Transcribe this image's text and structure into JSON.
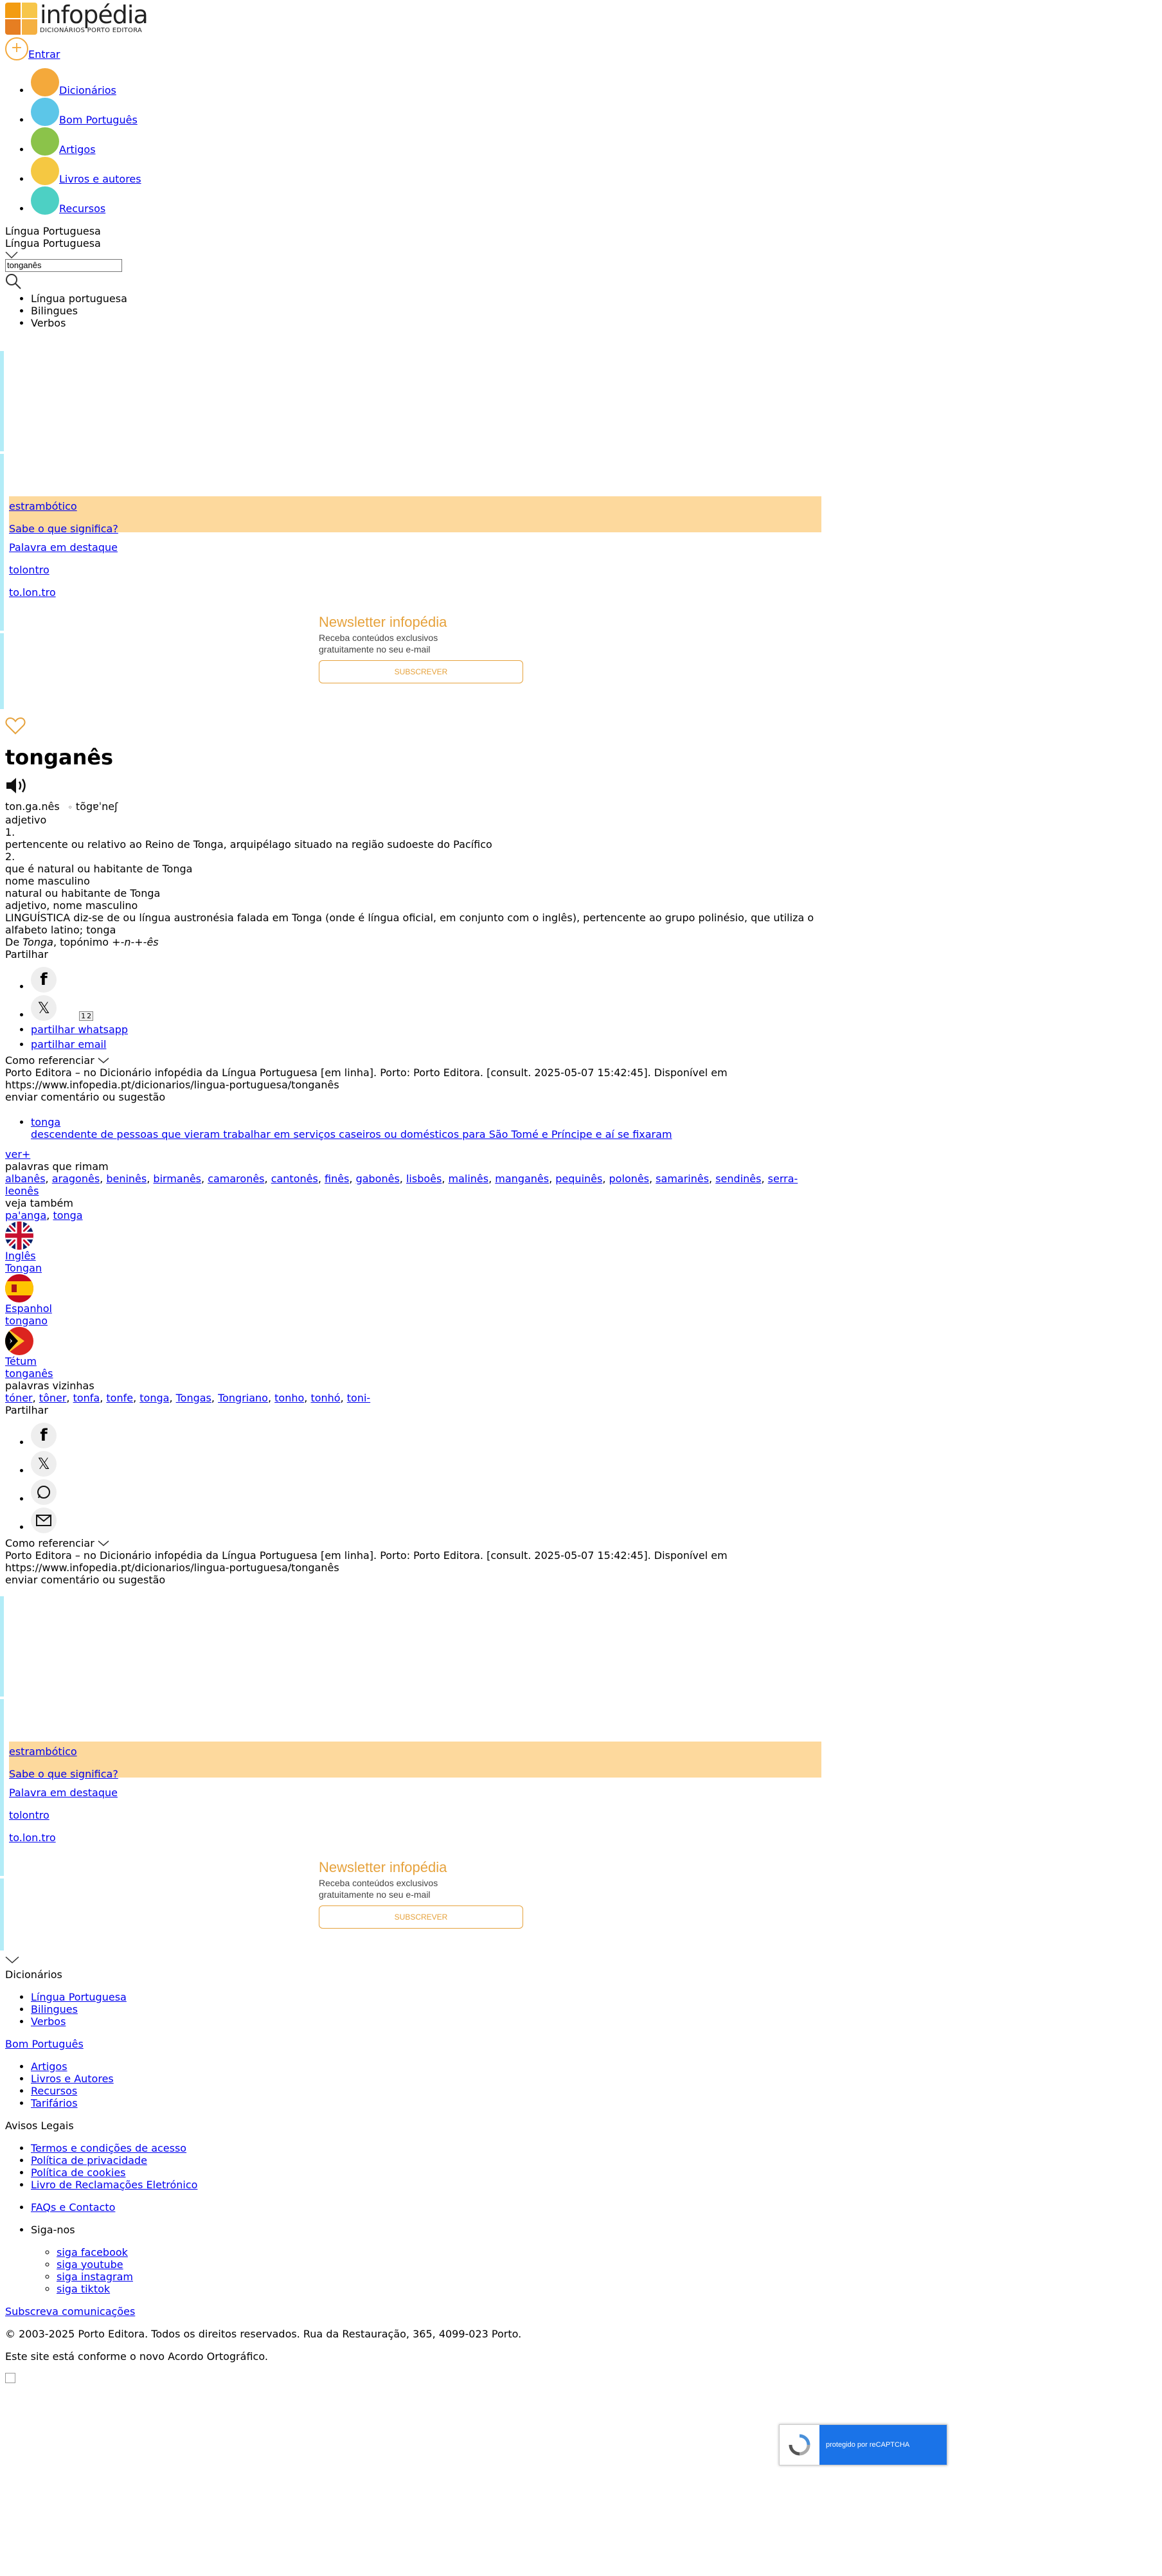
{
  "brand": {
    "name": "infopédia",
    "tagline": "DICIONÁRIOS PORTO EDITORA",
    "colors": [
      "#f39c12",
      "#f7c64a",
      "#e67e22",
      "#f5b041"
    ]
  },
  "header": {
    "login_label": "Entrar"
  },
  "nav": [
    {
      "label": "Dicionários",
      "icon": "book-icon",
      "color": "#f4a93b"
    },
    {
      "label": "Bom Português",
      "icon": "chat-bubble-icon",
      "color": "#5cc6e8"
    },
    {
      "label": "Artigos",
      "icon": "document-icon",
      "color": "#8bc34a"
    },
    {
      "label": "Livros e autores",
      "icon": "open-book-icon",
      "color": "#f5c842"
    },
    {
      "label": "Recursos",
      "icon": "resources-icon",
      "color": "#4dd0c4"
    }
  ],
  "search": {
    "dictionary_label": "Língua Portuguesa",
    "dictionary_selected": "Língua Portuguesa",
    "value": "tonganês",
    "options": [
      "Língua portuguesa",
      "Bilingues",
      "Verbos"
    ]
  },
  "promo": {
    "word": "estrambótico",
    "question": "Sabe o que significa?",
    "featured_label": "Palavra em destaque",
    "featured_word": "tolontro",
    "featured_syllables": "to.lon.tro"
  },
  "newsletter": {
    "title": "Newsletter infopédia",
    "text_1": "Receba conteúdos exclusivos",
    "text_2": "gratuitamente no seu e-mail",
    "button": "SUBSCREVER"
  },
  "entry": {
    "headword": "tonganês",
    "syllables": "ton.ga.nês",
    "ipa": "tõgɐˈneʃ",
    "pos_1": "adjetivo",
    "sense_1_num": "1.",
    "sense_1": "pertencente ou relativo ao Reino de Tonga, arquipélago situado na região sudoeste do Pacífico",
    "sense_2_num": "2.",
    "sense_2": "que é natural ou habitante de Tonga",
    "pos_2": "nome masculino",
    "sense_3": "natural ou habitante de Tonga",
    "pos_3": "adjetivo, nome masculino",
    "sense_4": "LINGUÍSTICA diz-se de ou língua austronésia falada em Tonga (onde é língua oficial, em conjunto com o inglês), pertencente ao grupo polinésio, que utiliza o alfabeto latino; tonga",
    "etym_prefix": "De ",
    "etym_word": "Tonga",
    "etym_mid": ", topónimo ",
    "etym_suffix": "+-n-+-ês"
  },
  "share": {
    "label": "Partilhar",
    "whatsapp_alt": "partilhar whatsapp",
    "email_alt": "partilhar email",
    "page_numbers": [
      "1",
      "2"
    ]
  },
  "citation": {
    "label": "Como referenciar",
    "text": "Porto Editora – no Dicionário infopédia da Língua Portuguesa [em linha]. Porto: Porto Editora. [consult. 2025-05-07 15:42:45]. Disponível em https://www.infopedia.pt/dicionarios/lingua-portuguesa/tonganês",
    "feedback": "enviar comentário ou sugestão"
  },
  "related": {
    "link": "tonga",
    "desc": "descendente de pessoas que vieram trabalhar em serviços caseiros ou domésticos para São Tomé e Príncipe e aí se fixaram",
    "more": "ver+",
    "rhymes_label": "palavras que rimam",
    "rhymes": [
      "albanês",
      "aragonês",
      "beninês",
      "birmanês",
      "camaronês",
      "cantonês",
      "finês",
      "gabonês",
      "lisboês",
      "malinês",
      "manganês",
      "pequinês",
      "polonês",
      "samarinês",
      "sendinês",
      "serra-leonês"
    ],
    "see_also_label": "veja também",
    "see_also": [
      "pa'anga",
      "tonga"
    ]
  },
  "translations": [
    {
      "lang": "Inglês",
      "word": "Tongan",
      "flag": "uk-flag-icon"
    },
    {
      "lang": "Espanhol",
      "word": "tongano",
      "flag": "spain-flag-icon"
    },
    {
      "lang": "Tétum",
      "word": "tonganês",
      "flag": "east-timor-flag-icon"
    }
  ],
  "neighbors": {
    "label": "palavras vizinhas",
    "words": [
      "tóner",
      "tôner",
      "tonfa",
      "tonfe",
      "tonga",
      "Tongas",
      "Tongriano",
      "tonho",
      "tonhó",
      "toni-"
    ]
  },
  "footer": {
    "dictionaries_label": "Dicionários",
    "dictionaries": [
      "Língua Portuguesa",
      "Bilingues",
      "Verbos"
    ],
    "bom_portugues": "Bom Português",
    "bom_items": [
      "Artigos",
      "Livros e Autores",
      "Recursos",
      "Tarifários"
    ],
    "legal_label": "Avisos Legais",
    "legal_items": [
      "Termos e condições de acesso",
      "Política de privacidade",
      "Política de cookies",
      "Livro de Reclamações Eletrónico"
    ],
    "faq": "FAQs e Contacto",
    "follow_label": "Siga-nos",
    "follow_items": [
      "siga facebook",
      "siga youtube",
      "siga instagram",
      "siga tiktok"
    ],
    "subscribe": "Subscreva comunicações",
    "copyright": "© 2003-2025 Porto Editora. Todos os direitos reservados. Rua da Restauração, 365, 4099-023 Porto.",
    "ao_note": "Este site está conforme o novo Acordo Ortográfico."
  },
  "recaptcha": {
    "text": "protegido por reCAPTCHA"
  }
}
